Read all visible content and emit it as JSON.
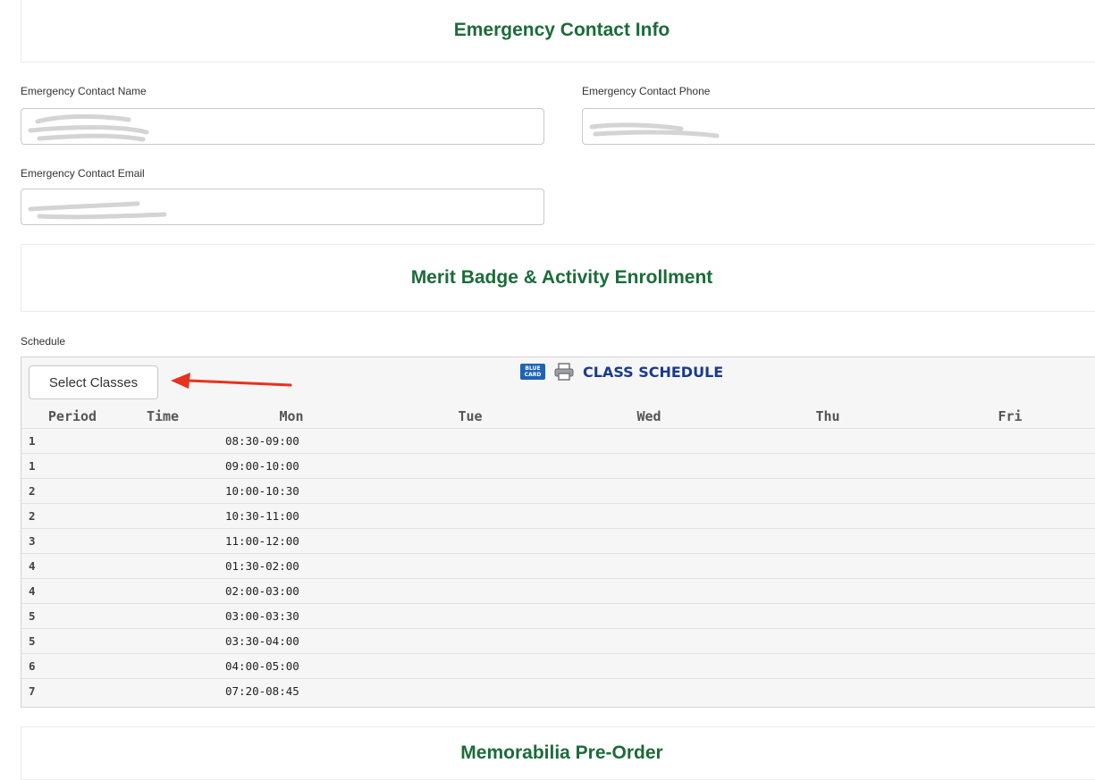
{
  "emergency": {
    "title": "Emergency Contact Info",
    "name_label": "Emergency Contact Name",
    "phone_label": "Emergency Contact Phone",
    "email_label": "Emergency Contact Email"
  },
  "enrollment": {
    "title": "Merit Badge & Activity Enrollment",
    "schedule_label": "Schedule",
    "select_button": "Select Classes",
    "schedule_title": "CLASS SCHEDULE",
    "bluecard_icon_text": "BLUE CARD",
    "columns": [
      "Period",
      "Time",
      "Mon",
      "Tue",
      "Wed",
      "Thu",
      "Fri"
    ],
    "rows": [
      {
        "period": "1",
        "time": "08:30-09:00"
      },
      {
        "period": "1",
        "time": "09:00-10:00"
      },
      {
        "period": "2",
        "time": "10:00-10:30"
      },
      {
        "period": "2",
        "time": "10:30-11:00"
      },
      {
        "period": "3",
        "time": "11:00-12:00"
      },
      {
        "period": "4",
        "time": "01:30-02:00"
      },
      {
        "period": "4",
        "time": "02:00-03:00"
      },
      {
        "period": "5",
        "time": "03:00-03:30"
      },
      {
        "period": "5",
        "time": "03:30-04:00"
      },
      {
        "period": "6",
        "time": "04:00-05:00"
      },
      {
        "period": "7",
        "time": "07:20-08:45"
      }
    ]
  },
  "memorabilia": {
    "title": "Memorabilia Pre-Order"
  },
  "colors": {
    "header_green": "#1c6b3a",
    "schedule_blue": "#1a3a8c",
    "arrow_red": "#e8321e"
  },
  "icons": [
    "bluecard-icon",
    "printer-icon",
    "red-arrow-annotation"
  ]
}
